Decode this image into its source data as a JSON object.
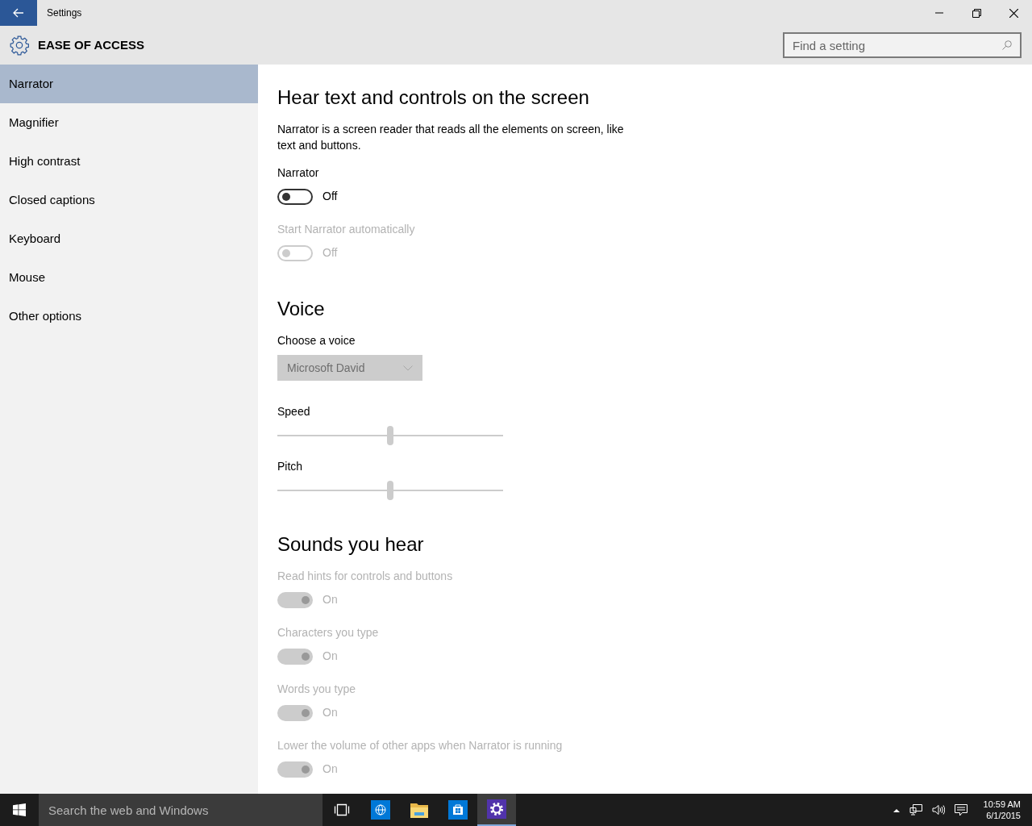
{
  "window": {
    "title": "Settings"
  },
  "header": {
    "title": "EASE OF ACCESS",
    "search": {
      "placeholder": "Find a setting"
    }
  },
  "sidebar": {
    "items": [
      {
        "label": "Narrator",
        "selected": true
      },
      {
        "label": "Magnifier",
        "selected": false
      },
      {
        "label": "High contrast",
        "selected": false
      },
      {
        "label": "Closed captions",
        "selected": false
      },
      {
        "label": "Keyboard",
        "selected": false
      },
      {
        "label": "Mouse",
        "selected": false
      },
      {
        "label": "Other options",
        "selected": false
      }
    ]
  },
  "content": [
    {
      "kind": "heading",
      "text": "Hear text and controls on the screen"
    },
    {
      "kind": "paragraph",
      "text": "Narrator is a screen reader that reads all the elements on screen, like text and buttons."
    },
    {
      "kind": "toggle",
      "label": "Narrator",
      "on": false,
      "disabled": false,
      "state_text": "Off"
    },
    {
      "kind": "toggle",
      "label": "Start Narrator automatically",
      "on": false,
      "disabled": true,
      "state_text": "Off"
    },
    {
      "kind": "heading",
      "text": "Voice"
    },
    {
      "kind": "dropdown",
      "label": "Choose a voice",
      "value": "Microsoft David",
      "disabled": true
    },
    {
      "kind": "slider",
      "label": "Speed",
      "level": 0.5
    },
    {
      "kind": "slider",
      "label": "Pitch",
      "level": 0.5
    },
    {
      "kind": "heading",
      "text": "Sounds you hear"
    },
    {
      "kind": "toggle",
      "label": "Read hints for controls and buttons",
      "on": true,
      "disabled": true,
      "state_text": "On"
    },
    {
      "kind": "toggle",
      "label": "Characters you type",
      "on": true,
      "disabled": true,
      "state_text": "On"
    },
    {
      "kind": "toggle",
      "label": "Words you type",
      "on": true,
      "disabled": true,
      "state_text": "On"
    },
    {
      "kind": "toggle",
      "label": "Lower the volume of other apps when Narrator is running",
      "on": true,
      "disabled": true,
      "state_text": "On"
    }
  ],
  "taskbar": {
    "search": {
      "placeholder": "Search the web and Windows"
    },
    "apps": [
      {
        "kind": "taskview",
        "selected": false
      },
      {
        "kind": "browser",
        "selected": false
      },
      {
        "kind": "folder",
        "selected": false
      },
      {
        "kind": "store",
        "selected": false
      },
      {
        "kind": "settings",
        "selected": true
      }
    ],
    "clock": {
      "time": "10:59 AM",
      "date": "6/1/2015"
    }
  }
}
